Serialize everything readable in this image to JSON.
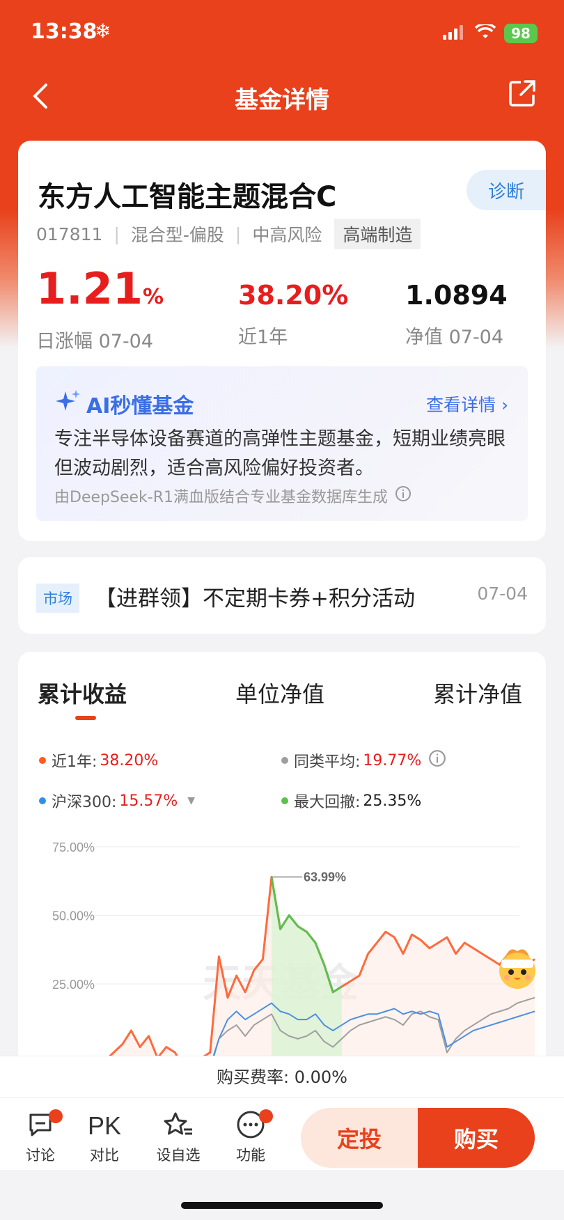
{
  "status": {
    "time": "13:38",
    "battery": "98"
  },
  "nav": {
    "title": "基金详情"
  },
  "fund": {
    "name": "东方人工智能主题混合C",
    "diagnose_label": "诊断",
    "code": "017811",
    "type": "混合型-偏股",
    "risk": "中高风险",
    "theme": "高端制造",
    "daily_change": "1.21",
    "daily_change_unit": "%",
    "daily_change_label": "日涨幅 07-04",
    "year_return": "38.20%",
    "year_return_label": "近1年",
    "nav_value": "1.0894",
    "nav_label": "净值 07-04"
  },
  "ai": {
    "title": "AI秒懂基金",
    "more": "查看详情",
    "text": "专注半导体设备赛道的高弹性主题基金，短期业绩亮眼但波动剧烈，适合高风险偏好投资者。",
    "footer": "由DeepSeek-R1满血版结合专业基金数据库生成"
  },
  "news": {
    "tag": "市场",
    "text": "【进群领】不定期卡券+积分活动",
    "date": "07-04"
  },
  "chart_tabs": [
    "累计收益",
    "单位净值",
    "累计净值"
  ],
  "legend": {
    "fund": {
      "label": "近1年:",
      "value": "38.20%"
    },
    "category": {
      "label": "同类平均:",
      "value": "19.77%"
    },
    "index": {
      "label": "沪深300:",
      "value": "15.57%"
    },
    "drawdown": {
      "label": "最大回撤:",
      "value": "25.35%"
    }
  },
  "watermark": "天天基金",
  "fee": {
    "label": "购买费率: 0.00%"
  },
  "bottom": {
    "discuss": "讨论",
    "pk_glyph": "PK",
    "compare": "对比",
    "watchlist": "设自选",
    "functions": "功能",
    "dingtou": "定投",
    "buy": "购买"
  },
  "colors": {
    "brand": "#e8411c",
    "rise": "#e61e1e",
    "fund_line": "#ff6a3d",
    "category_line": "#9e9e9e",
    "index_line": "#4a90e2",
    "drawdown_line": "#5cbf4f"
  },
  "chart_data": {
    "type": "line",
    "yticks": [
      "75.00%",
      "50.00%",
      "25.00%"
    ],
    "ylim": [
      0,
      75
    ],
    "peak_label": "63.99%",
    "x": [
      0,
      1,
      2,
      3,
      4,
      5,
      6,
      7,
      8,
      9,
      10,
      11,
      12,
      13,
      14,
      15,
      16,
      17,
      18,
      19,
      20,
      21,
      22,
      23,
      24,
      25,
      26,
      27,
      28,
      29,
      30,
      31,
      32,
      33,
      34,
      35,
      36,
      37,
      38,
      39,
      40,
      41,
      42,
      43,
      44,
      45,
      46,
      47,
      48,
      49,
      50
    ],
    "series": [
      {
        "name": "近1年",
        "values": [
          -5,
          -3,
          0,
          3,
          8,
          2,
          6,
          -2,
          2,
          0,
          -6,
          -4,
          -2,
          0,
          35,
          20,
          28,
          22,
          30,
          34,
          64,
          45,
          50,
          46,
          44,
          40,
          32,
          22,
          24,
          26,
          28,
          36,
          40,
          44,
          42,
          36,
          43,
          41,
          38,
          40,
          42,
          36,
          40,
          38,
          36,
          34,
          32,
          36,
          30,
          32,
          34
        ]
      },
      {
        "name": "同类平均",
        "values": [
          -6,
          -5,
          -4,
          -3,
          -2,
          -3,
          -2,
          -4,
          -3,
          -4,
          -8,
          -7,
          -6,
          -5,
          5,
          8,
          10,
          6,
          10,
          12,
          14,
          8,
          6,
          5,
          6,
          8,
          4,
          2,
          5,
          8,
          10,
          11,
          12,
          13,
          12,
          10,
          14,
          15,
          13,
          12,
          0,
          5,
          8,
          10,
          12,
          14,
          15,
          16,
          18,
          19,
          20
        ]
      },
      {
        "name": "沪深300",
        "values": [
          -7,
          -6,
          -5,
          -5,
          -4,
          -5,
          -4,
          -6,
          -5,
          -6,
          -9,
          -8,
          -7,
          -6,
          5,
          12,
          15,
          12,
          14,
          16,
          18,
          15,
          14,
          12,
          12,
          14,
          10,
          8,
          10,
          12,
          13,
          14,
          14,
          15,
          16,
          14,
          15,
          14,
          15,
          14,
          2,
          4,
          6,
          8,
          9,
          10,
          11,
          12,
          13,
          14,
          15
        ]
      },
      {
        "name": "最大回撤",
        "values": [
          null,
          null,
          null,
          null,
          null,
          null,
          null,
          null,
          null,
          null,
          null,
          null,
          null,
          null,
          null,
          null,
          null,
          null,
          null,
          null,
          64,
          45,
          50,
          46,
          44,
          40,
          32,
          22,
          24,
          null,
          null,
          null,
          null,
          null,
          null,
          null,
          null,
          null,
          null,
          null,
          null,
          null,
          null,
          null,
          null,
          null,
          null,
          null,
          null,
          null,
          null
        ]
      }
    ]
  }
}
